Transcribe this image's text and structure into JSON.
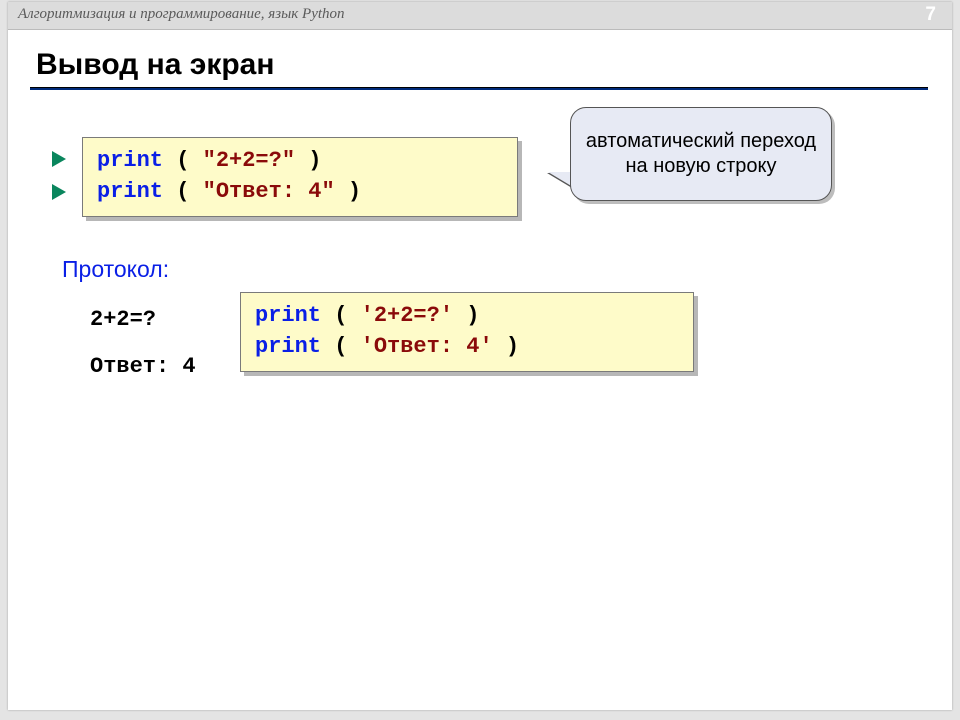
{
  "header": {
    "subject": "Алгоритмизация и программирование, язык Python",
    "page": "7"
  },
  "title": "Вывод на экран",
  "code1": {
    "kw1": "print",
    "paren_open": " ( ",
    "s1": "\"2+2=?\"",
    "paren_close": " )",
    "kw2": "print",
    "s2": "\"Ответ: 4\""
  },
  "callout": "автоматический переход на новую строку",
  "protocol_label": "Протокол:",
  "output": {
    "line1": "2+2=?",
    "line2": "Ответ: 4"
  },
  "code2": {
    "kw1": "print",
    "paren_open": " ( ",
    "s1": "'2+2=?'",
    "paren_close": " )",
    "kw2": "print",
    "s2": "'Ответ: 4'"
  }
}
